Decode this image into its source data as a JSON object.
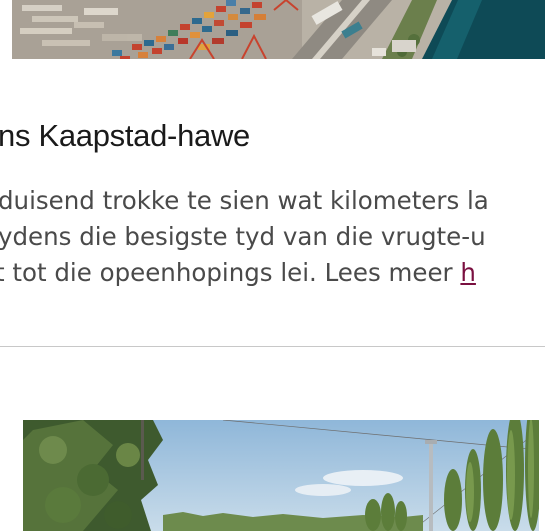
{
  "article": {
    "headline": "ns Kaapstad-hawe",
    "body_lines": [
      "duisend trokke te sien wat kilometers la",
      "ydens die besigste tyd van die vrugte-u",
      "t tot die opeenhopings lei. Lees meer "
    ],
    "read_more_link": "h"
  },
  "colors": {
    "link": "#7a1040",
    "body_text": "#4a4a4a",
    "headline": "#1a1a1a",
    "divider": "#c8c8c8"
  }
}
